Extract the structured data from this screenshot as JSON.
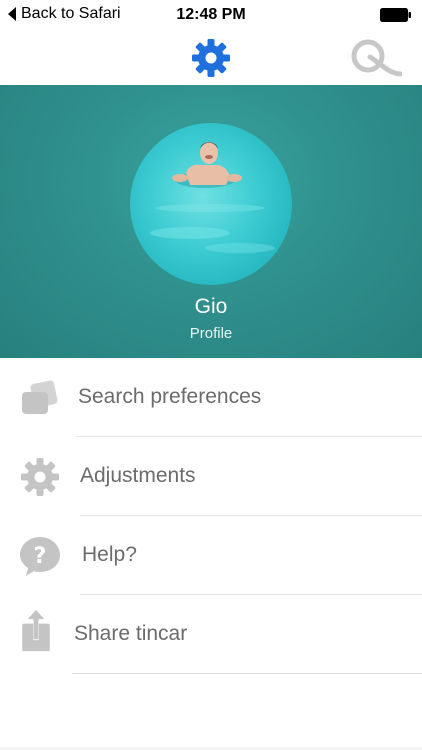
{
  "status_bar": {
    "back_label": "Back to Safari",
    "time": "12:48 PM"
  },
  "nav": {
    "settings_icon": "gear-icon",
    "logo_icon": "tincar-logo-icon",
    "accent_color": "#1f6fdc"
  },
  "profile": {
    "name": "Gio",
    "subtitle": "Profile",
    "header_color": "#2f908d"
  },
  "menu": {
    "items": [
      {
        "label": "Search preferences",
        "icon": "cards-icon"
      },
      {
        "label": "Adjustments",
        "icon": "gear-icon"
      },
      {
        "label": "Help?",
        "icon": "help-bubble-icon"
      },
      {
        "label": "Share tincar",
        "icon": "share-icon"
      }
    ],
    "icon_color": "#c4c4c4",
    "text_color": "#6b6b6b"
  }
}
